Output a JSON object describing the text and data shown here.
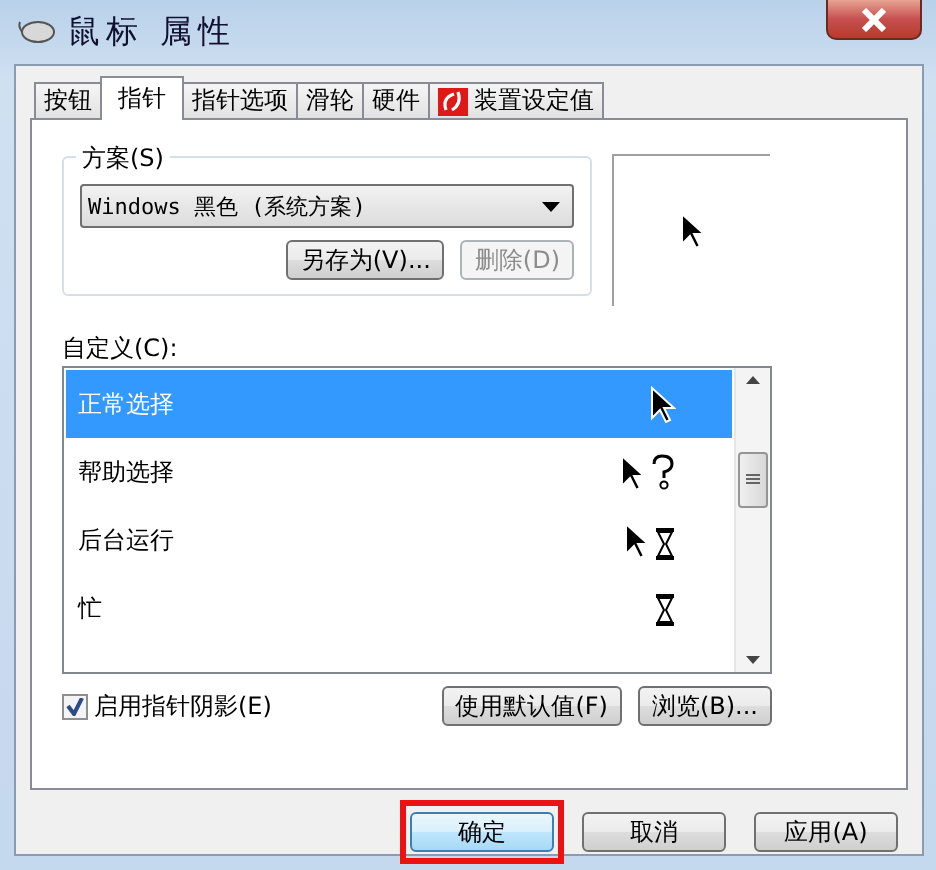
{
  "window": {
    "title": "鼠标 属性"
  },
  "tabs": [
    {
      "label": "按钮",
      "selected": false
    },
    {
      "label": "指针",
      "selected": true
    },
    {
      "label": "指针选项",
      "selected": false
    },
    {
      "label": "滑轮",
      "selected": false
    },
    {
      "label": "硬件",
      "selected": false
    },
    {
      "label": "装置设定值",
      "selected": false,
      "kind": "logo"
    }
  ],
  "scheme": {
    "label": "方案(S)",
    "value": "Windows 黑色 (系统方案)",
    "buttons": [
      {
        "label": "另存为(V)...",
        "disabled": false
      },
      {
        "label": "删除(D)",
        "disabled": true
      }
    ]
  },
  "customize": {
    "label": "自定义(C):",
    "items": [
      {
        "label": "正常选择",
        "selected": true
      },
      {
        "label": "帮助选择",
        "selected": false
      },
      {
        "label": "后台运行",
        "selected": false
      },
      {
        "label": "忙",
        "selected": false
      }
    ]
  },
  "shadow": {
    "label": "启用指针阴影(E)",
    "checked": true
  },
  "list_buttons": [
    "使用默认值(F)",
    "浏览(B)..."
  ],
  "dialog_buttons": [
    {
      "label": "确定",
      "highlighted": true
    },
    {
      "label": "取消",
      "highlighted": false
    },
    {
      "label": "应用(A)",
      "highlighted": false
    }
  ]
}
